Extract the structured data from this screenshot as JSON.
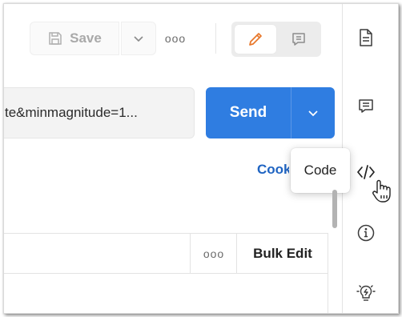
{
  "toolbar": {
    "save_label": "Save",
    "save_icon": "floppy-disk-icon",
    "save_dropdown_icon": "chevron-down-icon",
    "more_label": "ooo",
    "edit_mode_icon": "pencil-icon",
    "comment_mode_icon": "comment-icon"
  },
  "request": {
    "url_value": "te&minmagnitude=1...",
    "send_label": "Send",
    "send_dropdown_icon": "chevron-down-icon"
  },
  "links": {
    "cookies_label": "Cookies"
  },
  "tooltip": {
    "text": "Code"
  },
  "params_table": {
    "more_label": "ooo",
    "bulk_edit_label": "Bulk Edit"
  },
  "right_sidebar": {
    "items": [
      {
        "icon": "document-icon"
      },
      {
        "icon": "comment-icon"
      },
      {
        "icon": "code-icon"
      },
      {
        "icon": "info-icon"
      },
      {
        "icon": "lightbulb-icon"
      }
    ]
  },
  "colors": {
    "accent": "#2f7de1",
    "link": "#1f64c2",
    "pencil": "#e8772a"
  }
}
